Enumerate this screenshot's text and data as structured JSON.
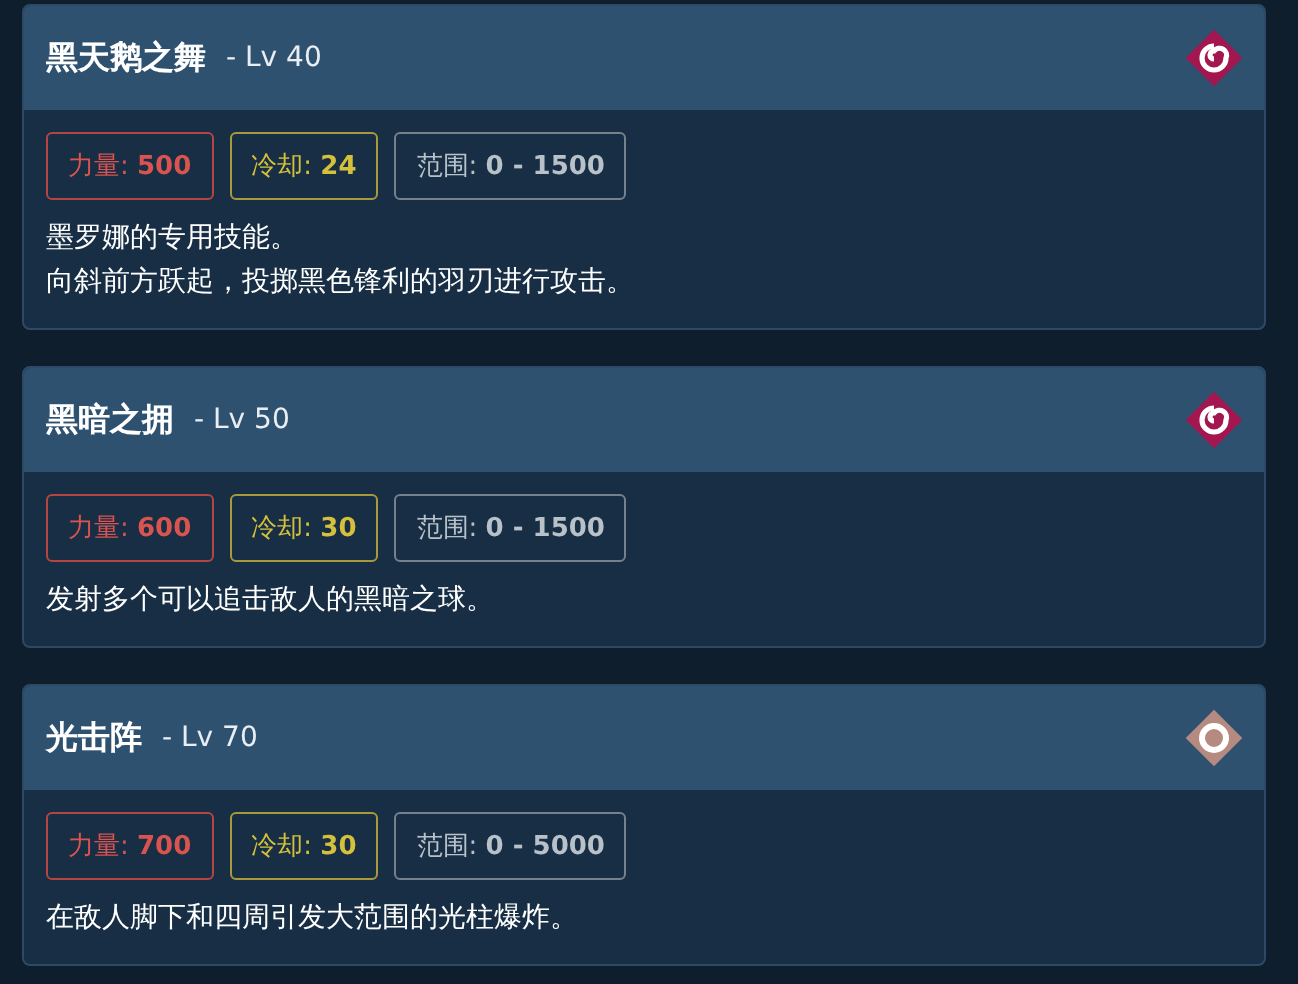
{
  "skills": [
    {
      "name": "黑天鹅之舞",
      "level": "- Lv 40",
      "icon": {
        "kind": "spiral",
        "color": "#a3164f"
      },
      "stats": [
        {
          "kind": "power",
          "label": "力量:",
          "value": "500"
        },
        {
          "kind": "cooldown",
          "label": "冷却:",
          "value": "24"
        },
        {
          "kind": "range",
          "label": "范围:",
          "value": "0 - 1500"
        }
      ],
      "description": [
        "墨罗娜的专用技能。",
        "向斜前方跃起，投掷黑色锋利的羽刃进行攻击。"
      ]
    },
    {
      "name": "黑暗之拥",
      "level": "- Lv 50",
      "icon": {
        "kind": "spiral",
        "color": "#a3164f"
      },
      "stats": [
        {
          "kind": "power",
          "label": "力量:",
          "value": "600"
        },
        {
          "kind": "cooldown",
          "label": "冷却:",
          "value": "30"
        },
        {
          "kind": "range",
          "label": "范围:",
          "value": "0 - 1500"
        }
      ],
      "description": [
        "发射多个可以追击敌人的黑暗之球。"
      ]
    },
    {
      "name": "光击阵",
      "level": "- Lv 70",
      "icon": {
        "kind": "ring",
        "color": "#b58a80"
      },
      "stats": [
        {
          "kind": "power",
          "label": "力量:",
          "value": "700"
        },
        {
          "kind": "cooldown",
          "label": "冷却:",
          "value": "30"
        },
        {
          "kind": "range",
          "label": "范围:",
          "value": "0 - 5000"
        }
      ],
      "description": [
        "在敌人脚下和四周引发大范围的光柱爆炸。"
      ]
    }
  ]
}
